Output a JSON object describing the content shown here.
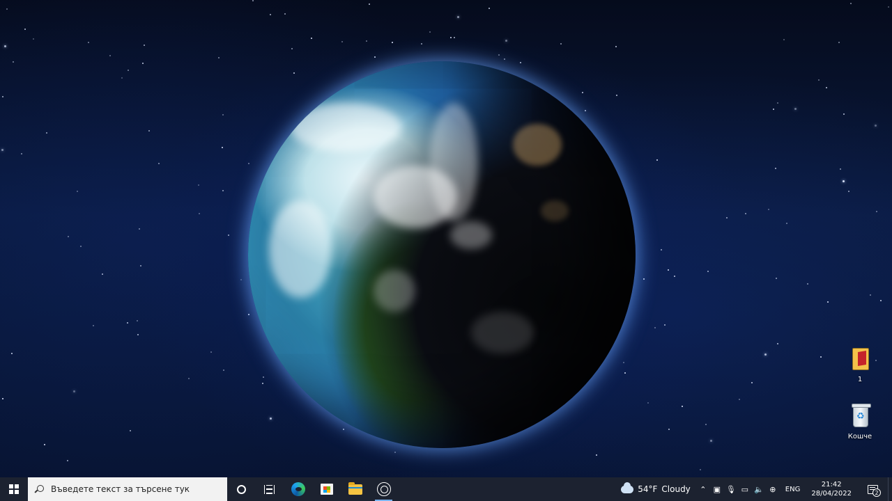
{
  "desktop": {
    "wallpaper": "earth-in-space",
    "icons": [
      {
        "label": "1",
        "icon": "file-icon"
      },
      {
        "label": "Кошче",
        "icon": "recycle-bin-icon"
      }
    ]
  },
  "taskbar": {
    "start_icon": "windows-logo-icon",
    "search": {
      "placeholder": "Въведете текст за търсене тук"
    },
    "apps": [
      {
        "name": "Cortana",
        "icon": "cortana-icon"
      },
      {
        "name": "Task View",
        "icon": "task-view-icon"
      },
      {
        "name": "Microsoft Edge",
        "icon": "edge-icon"
      },
      {
        "name": "Microsoft Store",
        "icon": "store-icon"
      },
      {
        "name": "File Explorer",
        "icon": "folder-icon"
      },
      {
        "name": "OBS Studio",
        "icon": "obs-icon",
        "active": true
      }
    ],
    "weather": {
      "temp": "54°F",
      "condition": "Cloudy"
    },
    "tray_icons": [
      "chevron-up-icon",
      "security-icon",
      "microphone-icon",
      "battery-icon",
      "volume-icon",
      "network-icon"
    ],
    "language": "ENG",
    "clock": {
      "time": "21:42",
      "date": "28/04/2022"
    },
    "notifications": {
      "count": "2"
    }
  },
  "colors": {
    "taskbar_bg": "#1c2230",
    "accent": "#7ab4f0",
    "search_bg": "#f2f2f2"
  }
}
